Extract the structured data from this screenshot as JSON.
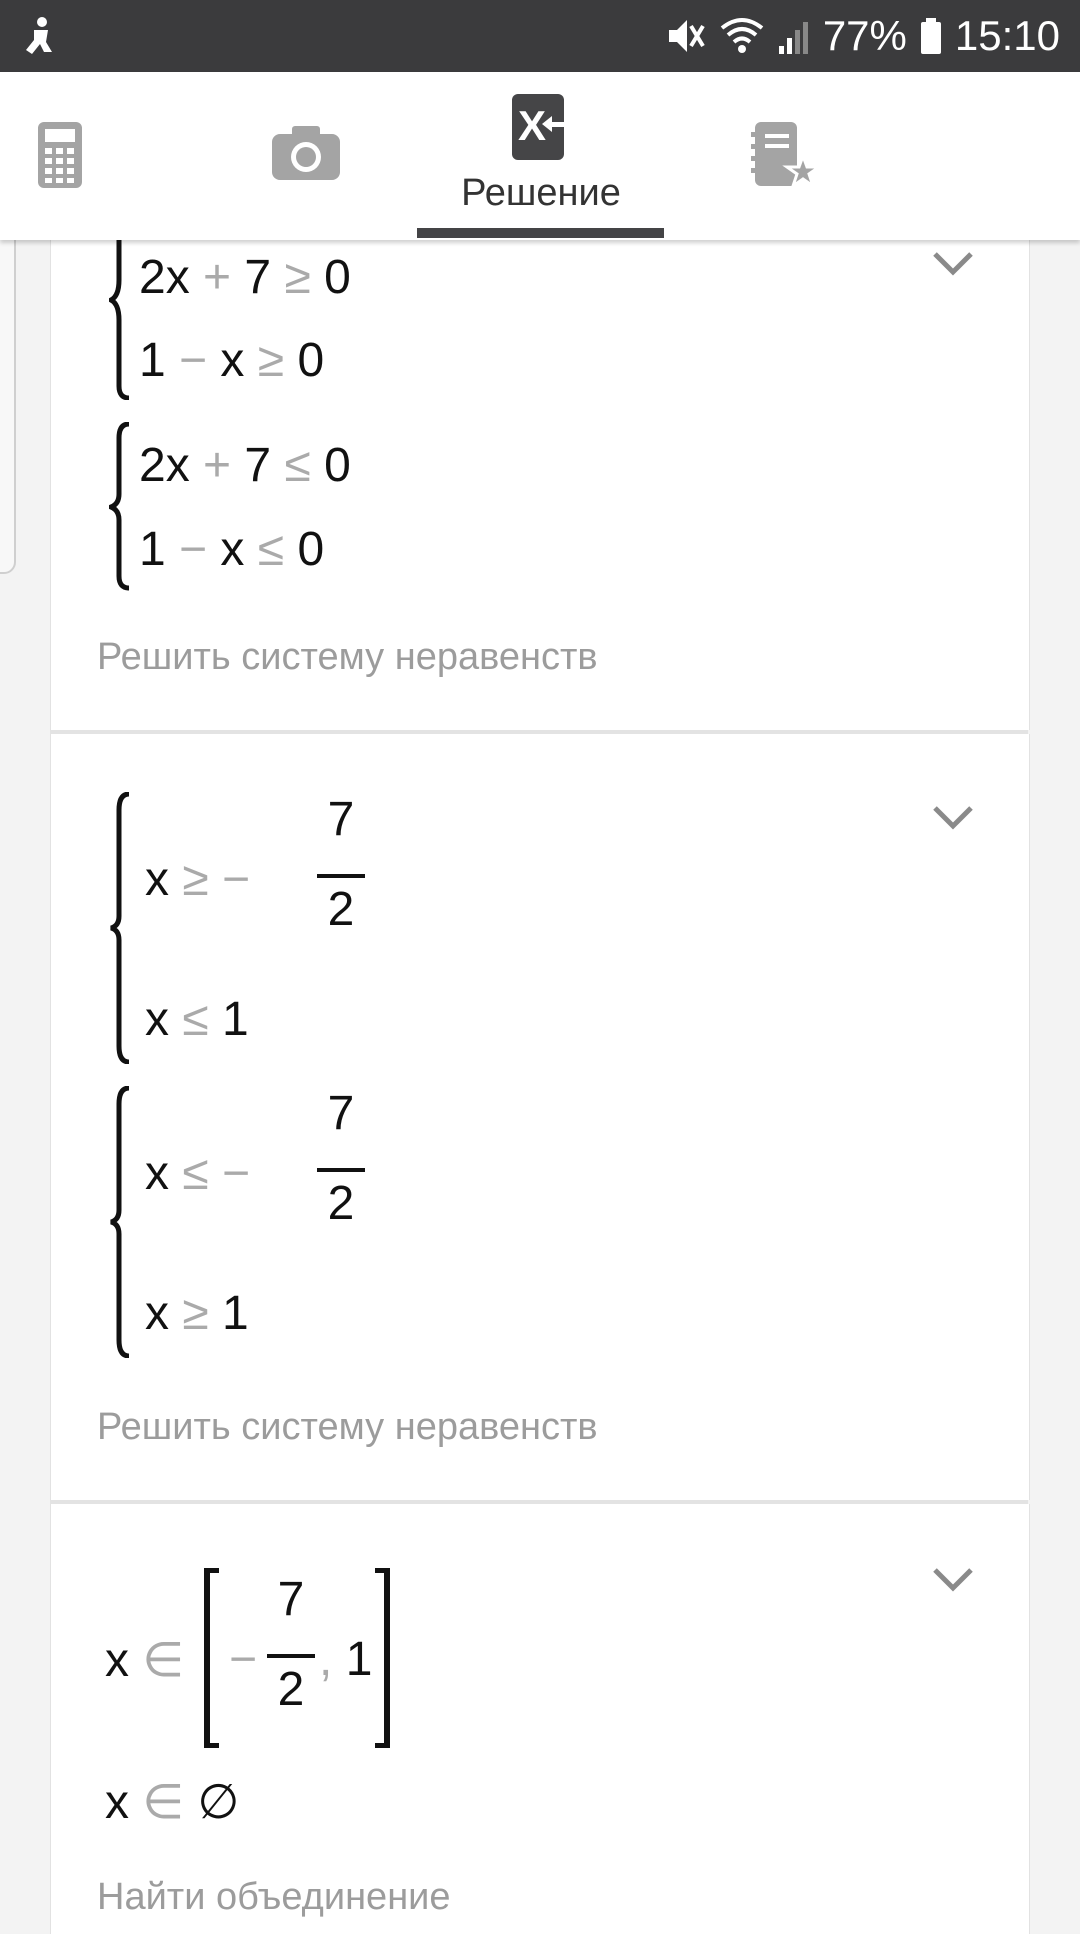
{
  "status_bar": {
    "battery_percent": "77%",
    "time": "15:10"
  },
  "tabs": [
    {
      "name": "calculator",
      "icon": "calculator-icon",
      "label": ""
    },
    {
      "name": "camera",
      "icon": "camera-icon",
      "label": ""
    },
    {
      "name": "solution",
      "icon": "solution-icon",
      "label": "Решение",
      "active": true
    },
    {
      "name": "favorites",
      "icon": "notebook-star-icon",
      "label": ""
    }
  ],
  "cards": [
    {
      "systems": [
        {
          "lines": [
            {
              "a": "2x",
              "op1": "+",
              "b": "7",
              "op2": "≥",
              "c": "0"
            },
            {
              "a": "1",
              "op1": "−",
              "b": "x",
              "op2": "≥",
              "c": "0"
            }
          ]
        },
        {
          "lines": [
            {
              "a": "2x",
              "op1": "+",
              "b": "7",
              "op2": "≤",
              "c": "0"
            },
            {
              "a": "1",
              "op1": "−",
              "b": "x",
              "op2": "≤",
              "c": "0"
            }
          ]
        }
      ],
      "caption": "Решить систему неравенств"
    },
    {
      "systems": [
        {
          "line1": {
            "var": "x",
            "op": "≥",
            "neg": "−",
            "num": "7",
            "den": "2"
          },
          "line2": {
            "var": "x",
            "op": "≤",
            "val": "1"
          }
        },
        {
          "line1": {
            "var": "x",
            "op": "≤",
            "neg": "−",
            "num": "7",
            "den": "2"
          },
          "line2": {
            "var": "x",
            "op": "≥",
            "val": "1"
          }
        }
      ],
      "caption": "Решить систему неравенств"
    },
    {
      "interval": {
        "var": "x",
        "op": "∈",
        "neg": "−",
        "num": "7",
        "den": "2",
        "comma": ",",
        "right": "1"
      },
      "empty": {
        "var": "x",
        "op": "∈",
        "set": "∅"
      },
      "caption": "Найти объединение"
    }
  ],
  "colors": {
    "status_bar_bg": "#3b3b3d",
    "tab_indicator": "#444446",
    "caption_text": "#9c9c9c",
    "operator_text": "#aaaaaa"
  }
}
